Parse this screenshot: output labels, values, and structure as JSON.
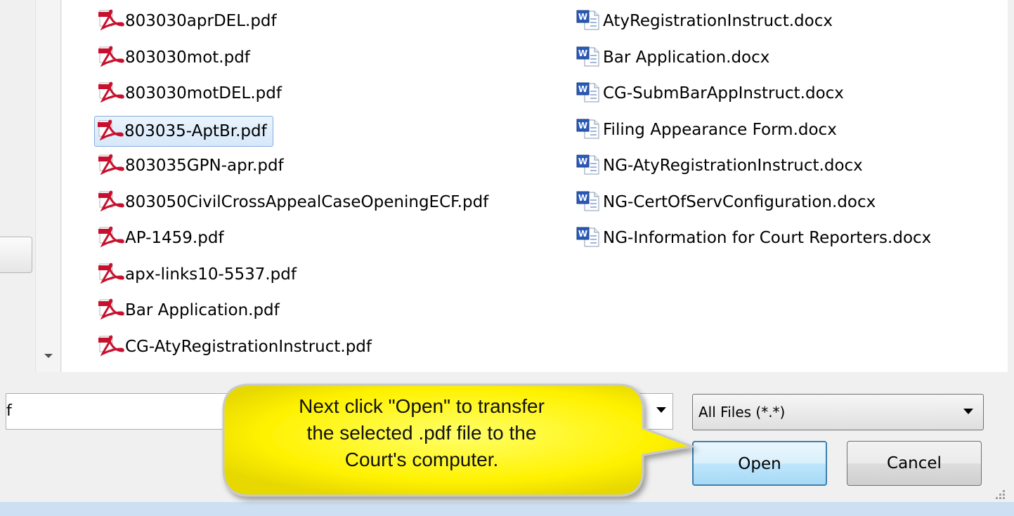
{
  "files_left": [
    {
      "name": "803030aprDEL.pdf",
      "type": "pdf"
    },
    {
      "name": "803030mot.pdf",
      "type": "pdf"
    },
    {
      "name": "803030motDEL.pdf",
      "type": "pdf"
    },
    {
      "name": "803035-AptBr.pdf",
      "type": "pdf",
      "selected": true
    },
    {
      "name": "803035GPN-apr.pdf",
      "type": "pdf"
    },
    {
      "name": "803050CivilCrossAppealCaseOpeningECF.pdf",
      "type": "pdf"
    },
    {
      "name": "AP-1459.pdf",
      "type": "pdf"
    },
    {
      "name": "apx-links10-5537.pdf",
      "type": "pdf"
    },
    {
      "name": "Bar Application.pdf",
      "type": "pdf"
    },
    {
      "name": "CG-AtyRegistrationInstruct.pdf",
      "type": "pdf"
    }
  ],
  "files_right": [
    {
      "name": "AtyRegistrationInstruct.docx",
      "type": "docx"
    },
    {
      "name": "Bar Application.docx",
      "type": "docx"
    },
    {
      "name": "CG-SubmBarAppInstruct.docx",
      "type": "docx"
    },
    {
      "name": "Filing Appearance Form.docx",
      "type": "docx"
    },
    {
      "name": "NG-AtyRegistrationInstruct.docx",
      "type": "docx"
    },
    {
      "name": "NG-CertOfServConfiguration.docx",
      "type": "docx"
    },
    {
      "name": "NG-Information for Court Reporters.docx",
      "type": "docx"
    }
  ],
  "icons": {
    "pdf": "pdf-file-icon",
    "docx": "word-document-icon"
  },
  "filename_value": "f",
  "filetype_selected": "All Files (*.*)",
  "open_label": "Open",
  "cancel_label": "Cancel",
  "callout": {
    "lines": [
      "Next click \"Open\" to transfer",
      "the selected .pdf file to the",
      "Court's computer."
    ]
  },
  "colors": {
    "selection_bg": "#d6e8fa",
    "selection_border": "#84acdd",
    "callout_fill": "#fff200",
    "status_bar": "#cde0f3"
  }
}
